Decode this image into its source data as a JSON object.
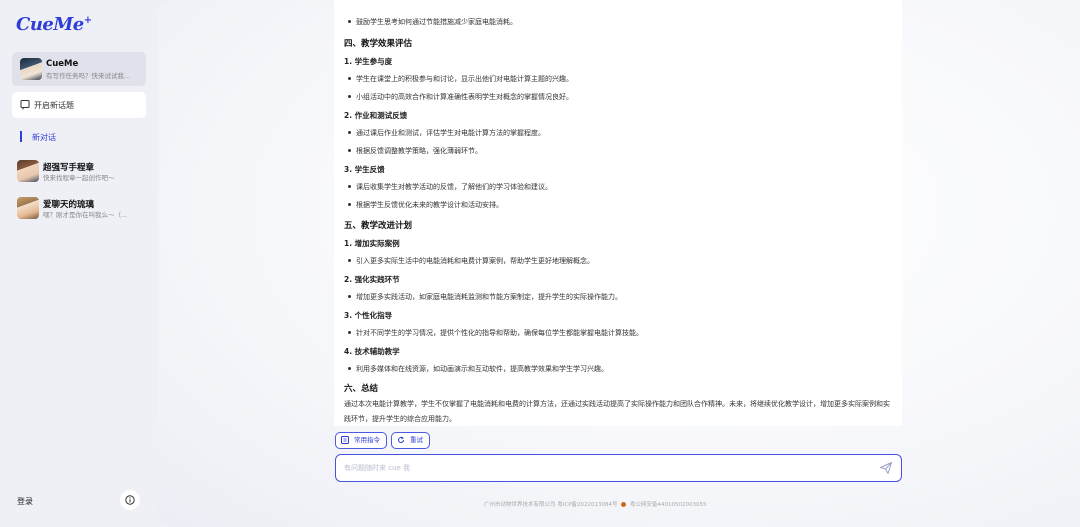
{
  "app": {
    "logo": "CueMe",
    "logo_mark": "+"
  },
  "sidebar": {
    "active_chat": {
      "title": "CueMe",
      "subtitle": "有写作任务吗？快来试试我..."
    },
    "new_topic_label": "开启新话题",
    "new_chat_label": "新对话",
    "chats": [
      {
        "title": "超强写手程章",
        "subtitle": "快来找程章一起创作吧～"
      },
      {
        "title": "爱聊天的琉璃",
        "subtitle": "嘿？刚才是你在叫我么～（..."
      }
    ],
    "login_label": "登录"
  },
  "content": {
    "top_bullet": "鼓励学生思考如何通过节能措施减少家庭电能消耗。",
    "sec4": "四、教学效果评估",
    "s4_1": "1. 学生参与度",
    "s4_1_b1": "学生在课堂上的积极参与和讨论，显示出他们对电能计算主题的兴趣。",
    "s4_1_b2": "小组活动中的高效合作和计算准确性表明学生对概念的掌握情况良好。",
    "s4_2": "2. 作业和测试反馈",
    "s4_2_b1": "通过课后作业和测试，评估学生对电能计算方法的掌握程度。",
    "s4_2_b2": "根据反馈调整教学策略，强化薄弱环节。",
    "s4_3": "3. 学生反馈",
    "s4_3_b1": "课后收集学生对教学活动的反馈，了解他们的学习体验和建议。",
    "s4_3_b2": "根据学生反馈优化未来的教学设计和活动安排。",
    "sec5": "五、教学改进计划",
    "s5_1": "1. 增加实际案例",
    "s5_1_b1": "引入更多实际生活中的电能消耗和电费计算案例，帮助学生更好地理解概念。",
    "s5_2": "2. 强化实践环节",
    "s5_2_b1": "增加更多实践活动，如家庭电能消耗监测和节能方案制定，提升学生的实际操作能力。",
    "s5_3": "3. 个性化指导",
    "s5_3_b1": "针对不同学生的学习情况，提供个性化的指导和帮助，确保每位学生都能掌握电能计算技能。",
    "s5_4": "4. 技术辅助教学",
    "s5_4_b1": "利用多媒体和在线资源，如动画演示和互动软件，提高教学效果和学生学习兴趣。",
    "sec6": "六、总结",
    "summary": "通过本次电能计算教学，学生不仅掌握了电能消耗和电费的计算方法，还通过实践活动提高了实际操作能力和团队合作精神。未来，将继续优化教学设计，增加更多实际案例和实践环节，提升学生的综合应用能力。"
  },
  "actions": {
    "commands_label": "常用指令",
    "retry_label": "重试"
  },
  "input": {
    "placeholder": "有问题随时来 cue 我"
  },
  "footer": {
    "icp": "广州市动物世界技术有限公司 粤ICP备2022013084号",
    "police": "粤公网安备44010502003055"
  }
}
